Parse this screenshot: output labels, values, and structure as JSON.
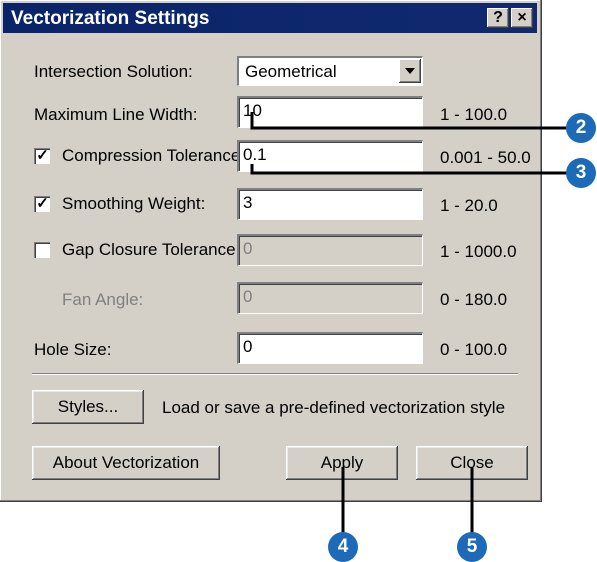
{
  "title": "Vectorization Settings",
  "title_buttons": [
    "?",
    "×"
  ],
  "intersection_solution": {
    "label": "Intersection Solution:",
    "value": "Geometrical"
  },
  "maximum_line_width": {
    "label": "Maximum Line Width:",
    "value": "10",
    "range": "1 - 100.0"
  },
  "compression_tolerance": {
    "label": "Compression Tolerance:",
    "value": "0.1",
    "range": "0.001 - 50.0",
    "checked": true
  },
  "smoothing_weight": {
    "label": "Smoothing Weight:",
    "value": "3",
    "range": "1 - 20.0",
    "checked": true
  },
  "gap_closure_tolerance": {
    "label": "Gap Closure Tolerance:",
    "value": "0",
    "range": "1 - 1000.0",
    "checked": false
  },
  "fan_angle": {
    "label": "Fan Angle:",
    "value": "0",
    "range": "0 - 180.0"
  },
  "hole_size": {
    "label": "Hole Size:",
    "value": "0",
    "range": "0 - 100.0"
  },
  "styles": {
    "button": "Styles...",
    "description": "Load or save a pre-defined vectorization style"
  },
  "buttons": {
    "about": "About Vectorization",
    "apply": "Apply",
    "close": "Close"
  },
  "callouts": [
    "2",
    "3",
    "4",
    "5"
  ],
  "colors": {
    "title_bar": "#0a246a",
    "dialog_bg": "#d4d0c8",
    "callout": "#1d6bb8"
  }
}
